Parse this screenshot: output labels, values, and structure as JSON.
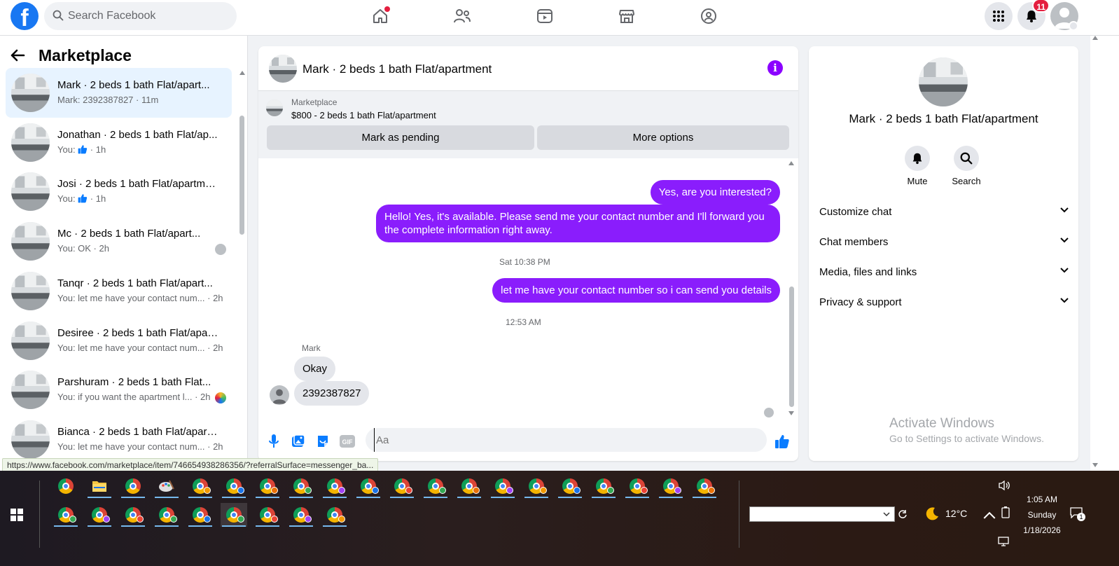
{
  "topbar": {
    "logo": "f",
    "search_placeholder": "Search Facebook",
    "notifications_count": "11",
    "nav_icons": [
      "home-icon",
      "friends-icon",
      "video-icon",
      "marketplace-icon",
      "groups-icon"
    ]
  },
  "sidebar": {
    "title": "Marketplace",
    "conversations": [
      {
        "title": "Mark · 2 beds 1 bath Flat/apart...",
        "sub": "Mark: 2392387827 · 11m"
      },
      {
        "title": "Jonathan · 2 beds 1 bath Flat/ap...",
        "sub_prefix": "You: ",
        "sub_suffix": " · 1h"
      },
      {
        "title": "Josi · 2 beds 1 bath Flat/apartme...",
        "sub_prefix": "You: ",
        "sub_suffix": " · 1h"
      },
      {
        "title": "Mc · 2 beds 1 bath Flat/apart...",
        "sub": "You: OK · 2h"
      },
      {
        "title": "Tanqr · 2 beds 1 bath Flat/apart...",
        "sub": "You: let me have your contact num... · 2h"
      },
      {
        "title": "Desiree · 2 beds 1 bath Flat/apar...",
        "sub": "You: let me have your contact num... · 2h"
      },
      {
        "title": "Parshuram · 2 beds 1 bath Flat...",
        "sub": "You: if you want the apartment l... · 2h"
      },
      {
        "title": "Bianca · 2 beds 1 bath Flat/apart...",
        "sub": "You: let me have your contact num... · 2h"
      }
    ]
  },
  "status_url": "https://www.facebook.com/marketplace/item/746654938286356/?referralSurface=messenger_ba...",
  "chat": {
    "title": "Mark · 2 beds 1 bath Flat/apartment",
    "marketplace_label": "Marketplace",
    "listing": "$800 - 2 beds 1 bath Flat/apartment",
    "btn_pending": "Mark as pending",
    "btn_more": "More options",
    "messages": {
      "out1": "Yes, are you interested?",
      "out2": "Hello! Yes, it's available. Please send me your contact number and I'll forward you the complete information right away.",
      "ts1": "Sat 10:38 PM",
      "out3": "let me have your contact number so i can send you details",
      "ts2": "12:53 AM",
      "sender": "Mark",
      "in1": "Okay",
      "in2": "2392387827"
    },
    "composer_placeholder": "Aa"
  },
  "info_panel": {
    "title": "Mark · 2 beds 1 bath Flat/apartment",
    "mute_label": "Mute",
    "search_label": "Search",
    "sections": [
      "Customize chat",
      "Chat members",
      "Media, files and links",
      "Privacy & support"
    ]
  },
  "activate": {
    "line1": "Activate Windows",
    "line2": "Go to Settings to activate Windows."
  },
  "taskbar": {
    "temperature": "12°C",
    "time": "1:05 AM",
    "day": "Sunday",
    "date": "1/18/2026",
    "notif_count": "1"
  },
  "colors": {
    "brand": "#1877f2",
    "outgoing_bubble": "#8a1dfc",
    "active_conv": "#e7f3ff"
  }
}
